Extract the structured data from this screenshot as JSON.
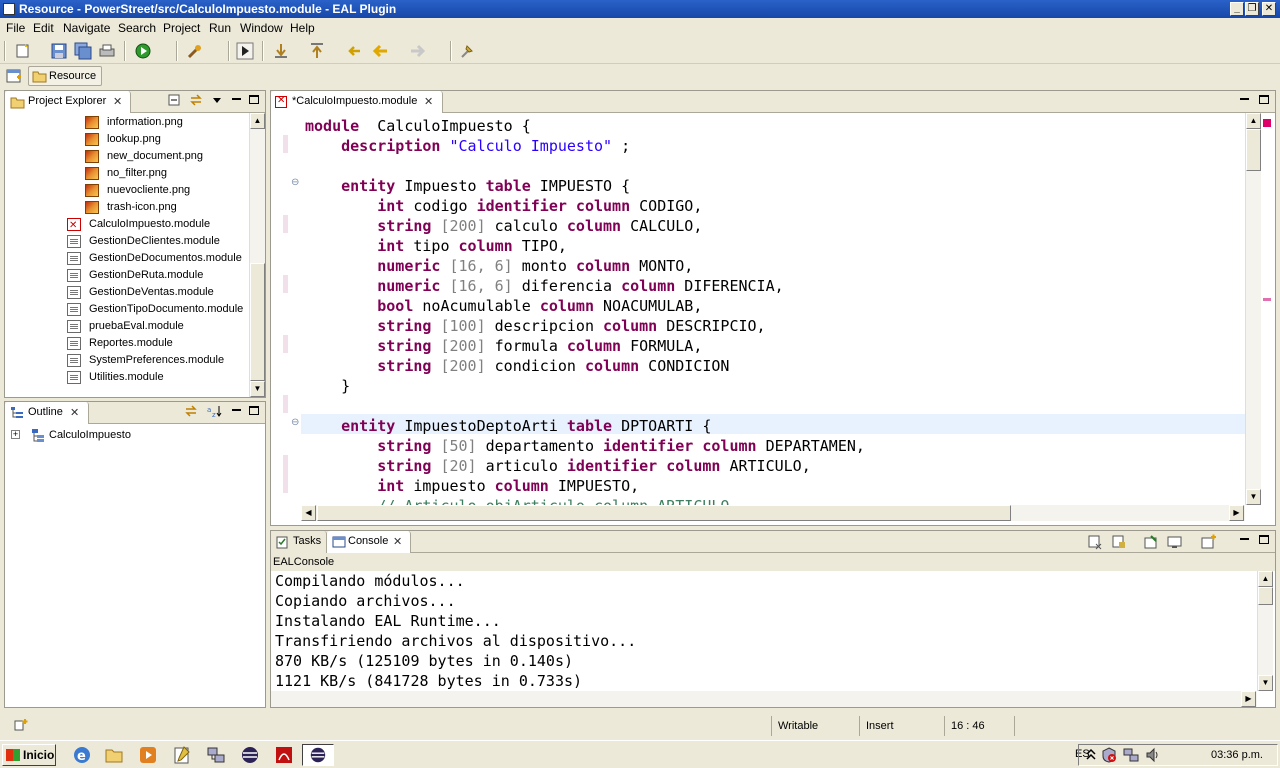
{
  "window": {
    "title": "Resource - PowerStreet/src/CalculoImpuesto.module - EAL Plugin",
    "controls": {
      "minimize": "_",
      "restore": "❐",
      "close": "✕"
    }
  },
  "menu": [
    "File",
    "Edit",
    "Navigate",
    "Search",
    "Project",
    "Run",
    "Window",
    "Help"
  ],
  "perspective": {
    "label": "Resource"
  },
  "project_explorer": {
    "title": "Project Explorer",
    "close": "✕",
    "items": [
      {
        "label": "information.png",
        "type": "png"
      },
      {
        "label": "lookup.png",
        "type": "png"
      },
      {
        "label": "new_document.png",
        "type": "png"
      },
      {
        "label": "no_filter.png",
        "type": "png"
      },
      {
        "label": "nuevocliente.png",
        "type": "png"
      },
      {
        "label": "trash-icon.png",
        "type": "png"
      },
      {
        "label": "CalculoImpuesto.module",
        "type": "module-error"
      },
      {
        "label": "GestionDeClientes.module",
        "type": "module"
      },
      {
        "label": "GestionDeDocumentos.module",
        "type": "module"
      },
      {
        "label": "GestionDeRuta.module",
        "type": "module"
      },
      {
        "label": "GestionDeVentas.module",
        "type": "module"
      },
      {
        "label": "GestionTipoDocumento.module",
        "type": "module"
      },
      {
        "label": "pruebaEval.module",
        "type": "module"
      },
      {
        "label": "Reportes.module",
        "type": "module"
      },
      {
        "label": "SystemPreferences.module",
        "type": "module"
      },
      {
        "label": "Utilities.module",
        "type": "module"
      }
    ]
  },
  "outline": {
    "title": "Outline",
    "close": "✕",
    "expander": "+",
    "items": [
      {
        "label": "CalculoImpuesto"
      }
    ]
  },
  "editor": {
    "tab_title": "*CalculoImpuesto.module",
    "close": "✕",
    "fold_marker": "⊖",
    "lines": [
      [
        [
          "kw",
          "module"
        ],
        [
          "",
          "  CalculoImpuesto {"
        ]
      ],
      [
        [
          "",
          "    "
        ],
        [
          "kw",
          "description"
        ],
        [
          "str",
          " \"Calculo Impuesto\""
        ],
        [
          "",
          " ;"
        ]
      ],
      [
        [
          "",
          ""
        ]
      ],
      [
        [
          "",
          "    "
        ],
        [
          "kw",
          "entity"
        ],
        [
          "",
          " Impuesto "
        ],
        [
          "kw",
          "table"
        ],
        [
          "",
          " IMPUESTO {"
        ]
      ],
      [
        [
          "",
          "        "
        ],
        [
          "kw",
          "int"
        ],
        [
          "",
          " codigo "
        ],
        [
          "kw",
          "identifier"
        ],
        [
          "",
          ""
        ],
        [
          "kw",
          " column"
        ],
        [
          "",
          " CODIGO,"
        ]
      ],
      [
        [
          "",
          "        "
        ],
        [
          "kw",
          "string"
        ],
        [
          "dim",
          " [200]"
        ],
        [
          "",
          " calculo "
        ],
        [
          "kw",
          "column"
        ],
        [
          "",
          " CALCULO,"
        ]
      ],
      [
        [
          "",
          "        "
        ],
        [
          "kw",
          "int"
        ],
        [
          "",
          " tipo "
        ],
        [
          "kw",
          "column"
        ],
        [
          "",
          " TIPO,"
        ]
      ],
      [
        [
          "",
          "        "
        ],
        [
          "kw",
          "numeric"
        ],
        [
          "dim",
          " [16, 6]"
        ],
        [
          "",
          " monto "
        ],
        [
          "kw",
          "column"
        ],
        [
          "",
          " MONTO,"
        ]
      ],
      [
        [
          "",
          "        "
        ],
        [
          "kw",
          "numeric"
        ],
        [
          "dim",
          " [16, 6]"
        ],
        [
          "",
          " diferencia "
        ],
        [
          "kw",
          "column"
        ],
        [
          "",
          " DIFERENCIA,"
        ]
      ],
      [
        [
          "",
          "        "
        ],
        [
          "kw",
          "bool"
        ],
        [
          "",
          " noAcumulable "
        ],
        [
          "kw",
          "column"
        ],
        [
          "",
          " NOACUMULAB,"
        ]
      ],
      [
        [
          "",
          "        "
        ],
        [
          "kw",
          "string"
        ],
        [
          "dim",
          " [100]"
        ],
        [
          "",
          " descripcion "
        ],
        [
          "kw",
          "column"
        ],
        [
          "",
          " DESCRIPCIO,"
        ]
      ],
      [
        [
          "",
          "        "
        ],
        [
          "kw",
          "string"
        ],
        [
          "dim",
          " [200]"
        ],
        [
          "",
          " formula "
        ],
        [
          "kw",
          "column"
        ],
        [
          "",
          " FORMULA,"
        ]
      ],
      [
        [
          "",
          "        "
        ],
        [
          "kw",
          "string"
        ],
        [
          "dim",
          " [200]"
        ],
        [
          "",
          " condicion "
        ],
        [
          "kw",
          "column"
        ],
        [
          "",
          " CONDICION"
        ]
      ],
      [
        [
          "",
          "    }"
        ]
      ],
      [
        [
          "",
          ""
        ]
      ],
      [
        [
          "",
          "    "
        ],
        [
          "kw",
          "entity"
        ],
        [
          "",
          " ImpuestoDeptoArti "
        ],
        [
          "kw",
          "table"
        ],
        [
          "",
          " DPTOARTI {"
        ]
      ],
      [
        [
          "",
          "        "
        ],
        [
          "kw",
          "string"
        ],
        [
          "dim",
          " [50]"
        ],
        [
          "",
          " departamento "
        ],
        [
          "kw",
          "identifier"
        ],
        [
          "kw",
          " column"
        ],
        [
          "",
          " DEPARTAMEN,"
        ]
      ],
      [
        [
          "",
          "        "
        ],
        [
          "kw",
          "string"
        ],
        [
          "dim",
          " [20]"
        ],
        [
          "",
          " articulo "
        ],
        [
          "kw",
          "identifier"
        ],
        [
          "kw",
          " column"
        ],
        [
          "",
          " ARTICULO,"
        ]
      ],
      [
        [
          "",
          "        "
        ],
        [
          "kw",
          "int"
        ],
        [
          "",
          " impuesto "
        ],
        [
          "kw",
          "column"
        ],
        [
          "",
          " IMPUESTO,"
        ]
      ],
      [
        [
          "cmt",
          "        // Articulo objArticulo column ARTICULO"
        ]
      ]
    ]
  },
  "bottom_panel": {
    "tabs": [
      {
        "label": "Tasks",
        "active": false
      },
      {
        "label": "Console",
        "active": true
      }
    ],
    "close": "✕",
    "console_name": "EALConsole",
    "lines": [
      "Compilando módulos...",
      "Copiando archivos...",
      "Instalando EAL Runtime...",
      "Transfiriendo archivos al dispositivo...",
      "870 KB/s (125109 bytes in 0.140s)",
      "1121 KB/s (841728 bytes in 0.733s)"
    ]
  },
  "status": {
    "mode": "Writable",
    "insert": "Insert",
    "position": "16 : 46"
  },
  "taskbar": {
    "start": "Inicio",
    "lang": "ES",
    "clock": "03:36 p.m."
  },
  "colors": {
    "keyword": "#7f0055",
    "string": "#2a00ff",
    "comment": "#3f7f5f",
    "title_bar": "#1f54b8"
  }
}
